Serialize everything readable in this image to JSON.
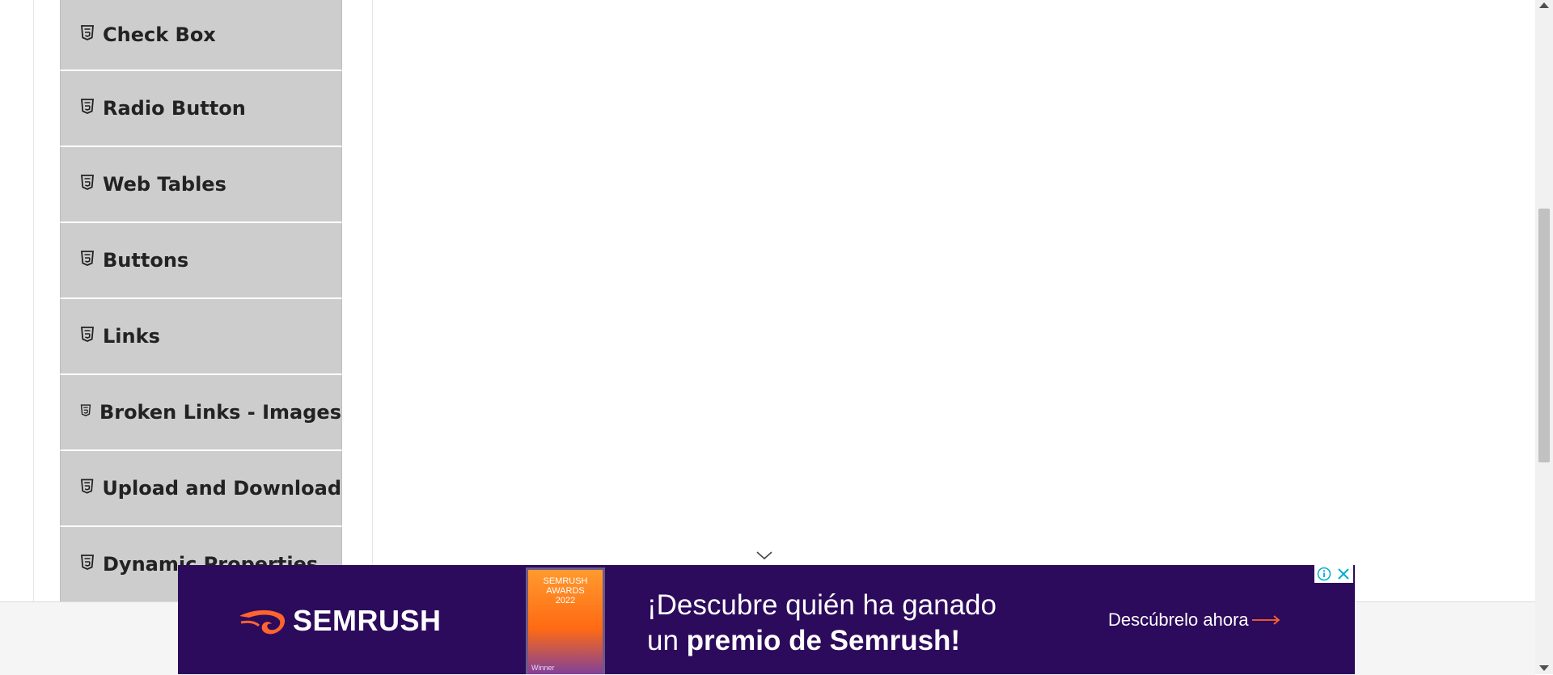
{
  "sidebar": {
    "items": [
      {
        "label": "Check Box"
      },
      {
        "label": "Radio Button"
      },
      {
        "label": "Web Tables"
      },
      {
        "label": "Buttons"
      },
      {
        "label": "Links"
      },
      {
        "label": "Broken Links - Images"
      },
      {
        "label": "Upload and Download"
      },
      {
        "label": "Dynamic Properties"
      }
    ],
    "item_icon": "html5-shield-icon"
  },
  "ad": {
    "brand": "SEMRUSH",
    "award_badge_line1": "SEMRUSH",
    "award_badge_line2": "AWARDS",
    "award_badge_year": "2022",
    "award_badge_footer": "Winner",
    "headline_line1": "¡Descubre quién ha ganado",
    "headline_line2_prefix": "un ",
    "headline_line2_bold": "premio de Semrush!",
    "cta": "Descúbrelo ahora",
    "background_color": "#2c0a5c",
    "accent_color": "#ff642d",
    "info_icon": "info-icon",
    "close_icon": "close-icon"
  },
  "colors": {
    "menu_item_bg": "#cdcdcd",
    "page_bg": "#ffffff"
  }
}
